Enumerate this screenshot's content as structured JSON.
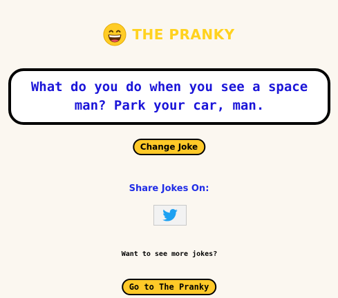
{
  "header": {
    "logo_icon": "grinning-face-emoji",
    "title": "THE PRANKY"
  },
  "joke": {
    "text": "What do you do when you see a space man? Park your car, man."
  },
  "actions": {
    "change_label": "Change Joke"
  },
  "share": {
    "label": "Share Jokes On:",
    "twitter_icon": "twitter-bird-icon"
  },
  "more": {
    "prompt": "Want to see more jokes?",
    "button_label": "Go to The Pranky"
  },
  "colors": {
    "background": "#fbf7f0",
    "brand_yellow": "#ffd21f",
    "joke_blue": "#1a14d8",
    "share_blue": "#1f2ce6",
    "button_yellow": "#ffc928",
    "twitter_blue": "#1da1f2"
  }
}
